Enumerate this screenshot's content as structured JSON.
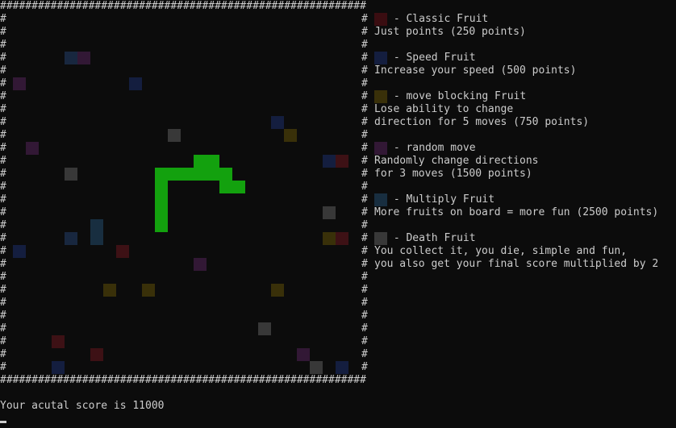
{
  "board": {
    "wall_char": "#",
    "top_row": "##########################################################",
    "bottom_row": "##########################################################"
  },
  "legend": {
    "classic_title": " - Classic Fruit",
    "classic_desc": "Just points (250 points)",
    "speed_title": " - Speed Fruit",
    "speed_desc": "Increase your speed (500 points)",
    "block_title": " - move blocking Fruit",
    "block_desc_1": "Lose ability to change",
    "block_desc_2": "direction for 5 moves (750 points)",
    "random_title": " - random move",
    "random_desc_1": "Randomly change directions",
    "random_desc_2": "for 3 moves (1500 points)",
    "multiply_title": " - Multiply Fruit",
    "multiply_desc": "More fruits on board = more fun (2500 points)",
    "death_title": " - Death Fruit",
    "death_desc_1": "You collect it, you die, simple and fun,",
    "death_desc_2": "you also get your final score multiplied by 2"
  },
  "colors": {
    "classic": "#c50f1f",
    "speed": "#0037da",
    "block": "#c19c00",
    "random": "#881798",
    "multiply": "#3a96dd",
    "death": "#cccccc",
    "snake": "#13a10e"
  },
  "status": {
    "score_text": "Your acutal score is 11000"
  }
}
